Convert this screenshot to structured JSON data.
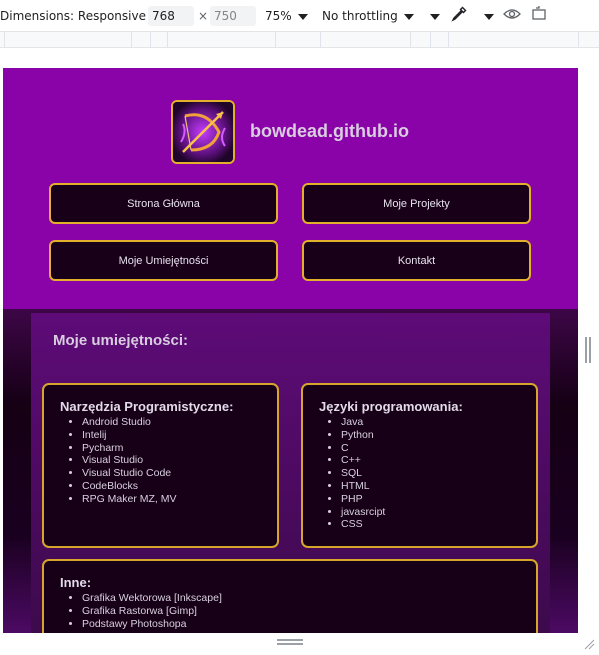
{
  "devtools": {
    "dimensions_label": "Dimensions: Responsive",
    "width_value": "768",
    "times": "×",
    "height_value": "750",
    "zoom": "75%",
    "throttling": "No throttling"
  },
  "site": {
    "title": "bowdead.github.io",
    "nav": [
      "Strona Główna",
      "Moje Projekty",
      "Moje Umiejętności",
      "Kontakt"
    ],
    "section_title": "Moje umiejętności:",
    "cards": [
      {
        "title": "Narzędzia Programistyczne:",
        "items": [
          "Android Studio",
          "Intelij",
          "Pycharm",
          "Visual Studio",
          "Visual Studio Code",
          "CodeBlocks",
          "RPG Maker MZ, MV"
        ]
      },
      {
        "title": "Języki programowania:",
        "items": [
          "Java",
          "Python",
          "C",
          "C++",
          "SQL",
          "HTML",
          "PHP",
          "javasrcipt",
          "CSS"
        ]
      },
      {
        "title": "Inne:",
        "items": [
          "Grafika Wektorowa [Inkscape]",
          "Grafika Rastorwa [Gimp]",
          "Podstawy Photoshopa"
        ]
      }
    ]
  },
  "colors": {
    "header_bg": "#8a03a8",
    "accent_gold": "#e2b02a",
    "card_bg": "#170017"
  }
}
